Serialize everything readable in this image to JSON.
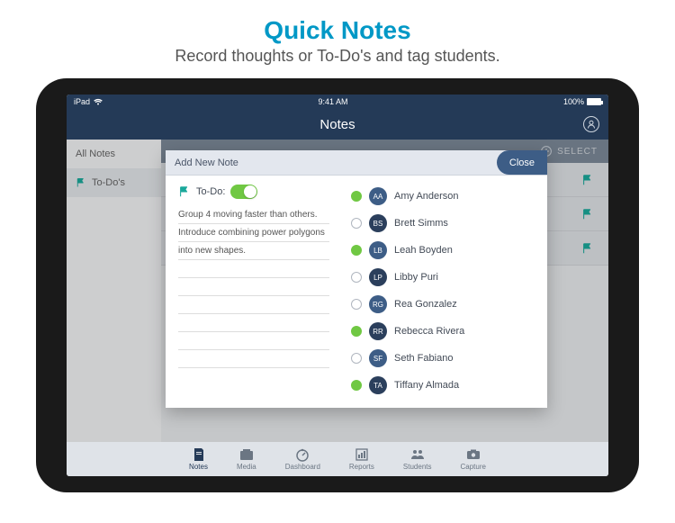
{
  "promo": {
    "title": "Quick Notes",
    "subtitle": "Record thoughts or To-Do's and tag students."
  },
  "statusbar": {
    "device": "iPad",
    "wifi": "wifi",
    "time": "9:41 AM",
    "battery_pct": "100%"
  },
  "nav": {
    "title": "Notes"
  },
  "selectbar": {
    "plus": "+",
    "select": "SELECT"
  },
  "sidebar": {
    "all": "All Notes",
    "todos": "To-Do's"
  },
  "modal": {
    "title": "Add New Note",
    "close": "Close",
    "todo_label": "To-Do:",
    "note_line1": "Group 4 moving faster than others.",
    "note_line2": "Introduce combining power polygons",
    "note_line3": "into new shapes."
  },
  "students": [
    {
      "initials": "AA",
      "name": "Amy Anderson",
      "selected": true
    },
    {
      "initials": "BS",
      "name": "Brett Simms",
      "selected": false
    },
    {
      "initials": "LB",
      "name": "Leah Boyden",
      "selected": true
    },
    {
      "initials": "LP",
      "name": "Libby Puri",
      "selected": false
    },
    {
      "initials": "RG",
      "name": "Rea Gonzalez",
      "selected": false
    },
    {
      "initials": "RR",
      "name": "Rebecca Rivera",
      "selected": true
    },
    {
      "initials": "SF",
      "name": "Seth Fabiano",
      "selected": false
    },
    {
      "initials": "TA",
      "name": "Tiffany Almada",
      "selected": true
    }
  ],
  "tabs": {
    "notes": "Notes",
    "media": "Media",
    "dashboard": "Dashboard",
    "reports": "Reports",
    "students": "Students",
    "capture": "Capture"
  }
}
